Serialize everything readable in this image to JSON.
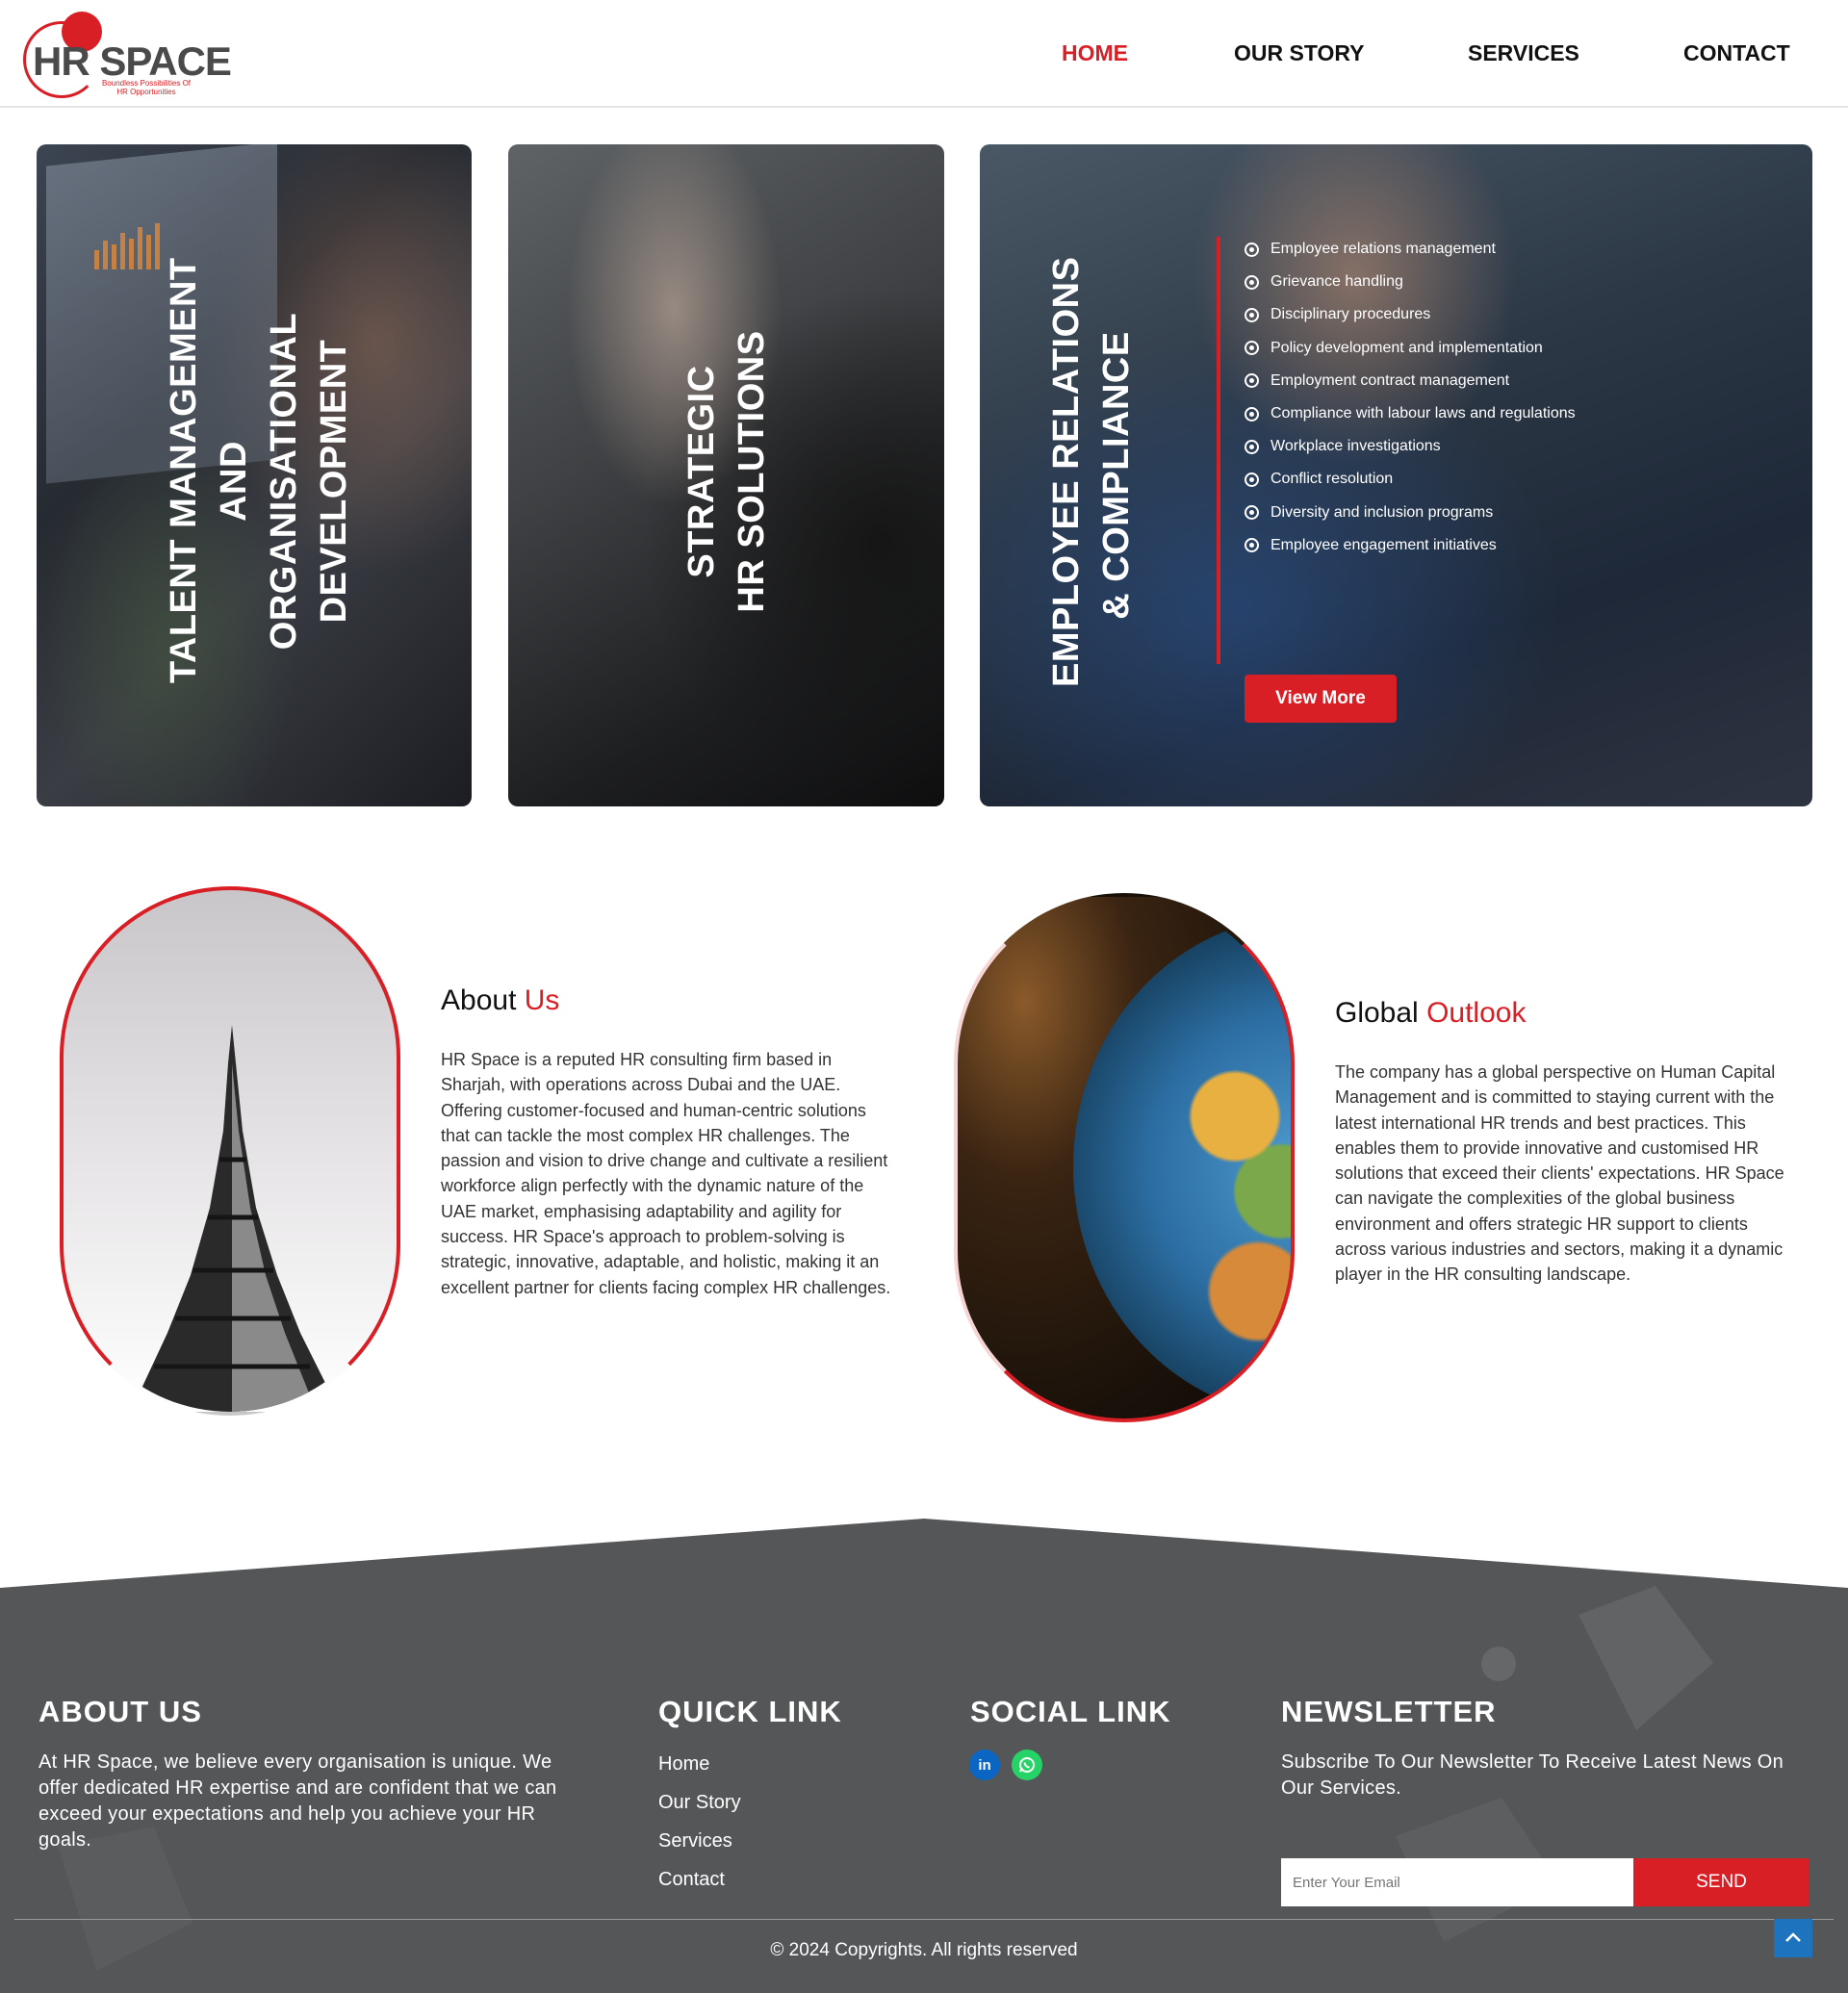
{
  "header": {
    "logo": {
      "mark": "HR SPACE",
      "tagline": "Boundless Possibilities Of HR Opportunities"
    },
    "nav": [
      {
        "label": "HOME",
        "active": true
      },
      {
        "label": "OUR STORY",
        "active": false
      },
      {
        "label": "SERVICES",
        "active": false
      },
      {
        "label": "CONTACT",
        "active": false
      }
    ]
  },
  "cards": [
    {
      "title_lines": [
        "TALENT MANAGEMENT",
        "AND",
        "ORGANISATIONAL",
        "DEVELOPMENT"
      ]
    },
    {
      "title_lines": [
        "STRATEGIC",
        "HR SOLUTIONS"
      ]
    },
    {
      "title_lines": [
        "EMPLOYEE RELATIONS",
        "& COMPLIANCE"
      ],
      "items": [
        "Employee relations management",
        "Grievance handling",
        "Disciplinary procedures",
        "Policy development and implementation",
        "Employment contract management",
        "Compliance with labour laws and regulations",
        "Workplace investigations",
        "Conflict resolution",
        "Diversity and inclusion programs",
        "Employee engagement initiatives"
      ],
      "button": "View More"
    }
  ],
  "about": {
    "title_plain": "About",
    "title_highlight": "Us",
    "text": "HR Space is a reputed HR consulting firm based in Sharjah, with operations across Dubai and the UAE. Offering customer-focused and human-centric solutions that can tackle the most complex HR challenges. The passion and vision to drive change and cultivate a resilient workforce align perfectly with the dynamic nature of the UAE market, emphasising adaptability and agility for success. HR Space's approach to problem-solving is strategic, innovative, adaptable, and holistic, making it an excellent partner for clients facing complex HR challenges."
  },
  "global": {
    "title_plain": "Global",
    "title_highlight": "Outlook",
    "text": "The company has a global perspective on Human Capital Management and is committed to staying current with the latest international HR trends and best practices. This enables them to provide innovative and customised HR solutions that exceed their clients' expectations. HR Space can navigate the complexities of the global business environment and offers strategic HR support to clients across various industries and sectors, making it a dynamic player in the HR consulting landscape."
  },
  "footer": {
    "about_heading": "ABOUT US",
    "about_text": "At HR Space, we believe every organisation is unique. We offer dedicated HR expertise and are confident that we can exceed your expectations and help you achieve your HR goals.",
    "quick_heading": "QUICK LINK",
    "quick_links": [
      "Home",
      "Our Story",
      "Services",
      "Contact"
    ],
    "social_heading": "SOCIAL LINK",
    "social_icons": [
      "linkedin-icon",
      "whatsapp-icon"
    ],
    "newsletter_heading": "NEWSLETTER",
    "newsletter_text": "Subscribe To Our Newsletter To Receive Latest News On Our Services.",
    "email_placeholder": "Enter Your Email",
    "send_label": "SEND",
    "copyright": "© 2024 Copyrights. All rights reserved"
  },
  "colors": {
    "accent": "#d91f26",
    "footer_bg": "#555658",
    "nav_active": "#d91f26",
    "scroll_top": "#1e73be"
  }
}
